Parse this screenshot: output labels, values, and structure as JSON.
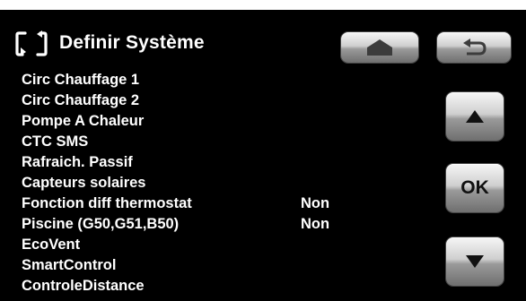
{
  "header": {
    "title": "Definir Système",
    "icon": "refresh-brackets-icon"
  },
  "buttons": {
    "home_icon": "home-icon",
    "back_icon": "back-arrow-icon",
    "up_icon": "up-triangle-icon",
    "ok_label": "OK",
    "down_icon": "down-triangle-icon"
  },
  "menu": {
    "items": [
      {
        "label": "Circ Chauffage 1",
        "value": ""
      },
      {
        "label": "Circ Chauffage 2",
        "value": ""
      },
      {
        "label": "Pompe A Chaleur",
        "value": ""
      },
      {
        "label": "CTC SMS",
        "value": ""
      },
      {
        "label": "Rafraich. Passif",
        "value": ""
      },
      {
        "label": "Capteurs solaires",
        "value": ""
      },
      {
        "label": "Fonction diff thermostat",
        "value": "Non"
      },
      {
        "label": "Piscine (G50,G51,B50)",
        "value": "Non"
      },
      {
        "label": "EcoVent",
        "value": ""
      },
      {
        "label": "SmartControl",
        "value": ""
      },
      {
        "label": "ControleDistance",
        "value": ""
      }
    ]
  },
  "colors": {
    "background": "#000000",
    "text": "#ffffff",
    "button_light": "#f6f6f6",
    "button_dark": "#6f6f6f"
  }
}
